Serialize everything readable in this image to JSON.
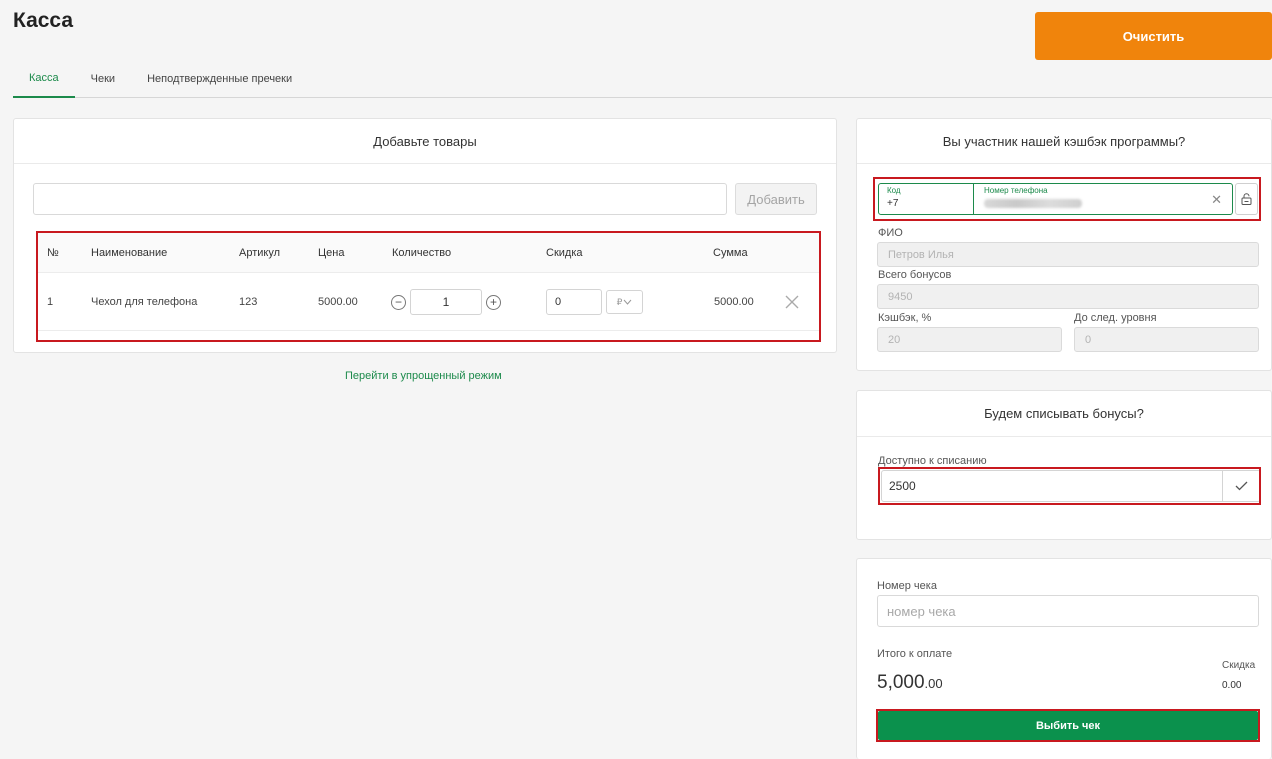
{
  "header": {
    "title": "Касса",
    "clear_label": "Очистить",
    "clear_color": "#f0840c"
  },
  "tabs": [
    {
      "label": "Касса",
      "active": true
    },
    {
      "label": "Чеки",
      "active": false
    },
    {
      "label": "Неподтвержденные пречеки",
      "active": false
    }
  ],
  "products": {
    "title": "Добавьте товары",
    "search_value": "",
    "add_label": "Добавить",
    "columns": [
      "№",
      "Наименование",
      "Артикул",
      "Цена",
      "Количество",
      "Скидка",
      "Сумма"
    ],
    "rows": [
      {
        "num": "1",
        "name": "Чехол для телефона",
        "sku": "123",
        "price": "5000.00",
        "quantity": "1",
        "discount": "0",
        "discount_unit": "₽",
        "sum": "5000.00"
      }
    ],
    "simple_mode_link": "Перейти в упрощенный режим"
  },
  "cashback": {
    "title": "Вы участник нашей кэшбэк программы?",
    "code_label": "Код",
    "code_value": "+7",
    "phone_label": "Номер телефона",
    "fio_label": "ФИО",
    "fio_value": "Петров Илья",
    "bonus_total_label": "Всего бонусов",
    "bonus_total_value": "9450",
    "cashback_label": "Кэшбэк, %",
    "cashback_value": "20",
    "next_level_label": "До след. уровня",
    "next_level_value": "0"
  },
  "bonus_writeoff": {
    "title": "Будем списывать бонусы?",
    "available_label": "Доступно к списанию",
    "available_value": "2500"
  },
  "receipt": {
    "number_label": "Номер чека",
    "number_placeholder": "номер чека",
    "number_value": "",
    "total_label": "Итого к оплате",
    "total_main": "5,000",
    "total_cents": ".00",
    "discount_label": "Скидка",
    "discount_value": "0.00",
    "pay_label": "Выбить чек",
    "pay_color": "#0b914d"
  },
  "annotations": {
    "highlight_color": "#c8191f"
  }
}
